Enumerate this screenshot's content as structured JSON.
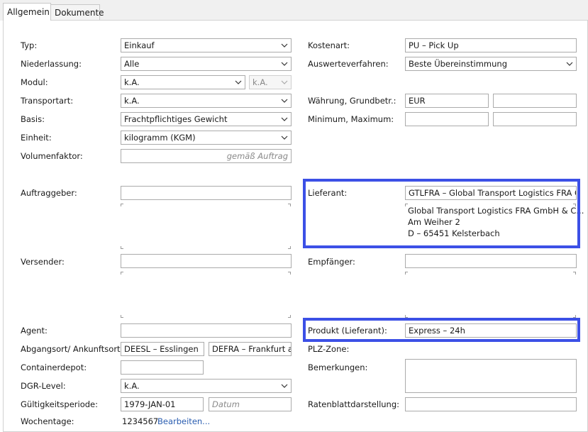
{
  "tabs": [
    "Allgemein",
    "Dokumente"
  ],
  "left": {
    "typ": {
      "label": "Typ:",
      "value": "Einkauf"
    },
    "niederlassung": {
      "label": "Niederlassung:",
      "value": "Alle"
    },
    "modul": {
      "label": "Modul:",
      "value": "k.A.",
      "value2": "k.A."
    },
    "transportart": {
      "label": "Transportart:",
      "value": "k.A."
    },
    "basis": {
      "label": "Basis:",
      "value": "Frachtpflichtiges Gewicht"
    },
    "einheit": {
      "label": "Einheit:",
      "value": "kilogramm (KGM)"
    },
    "volumenfaktor": {
      "label": "Volumenfaktor:",
      "placeholder": "gemäß Auftrag"
    },
    "auftraggeber": {
      "label": "Auftraggeber:"
    },
    "versender": {
      "label": "Versender:"
    },
    "agent": {
      "label": "Agent:"
    },
    "abgangsort": {
      "label": "Abgangsort/ Ankunftsort:",
      "from": "DEESL – Esslingen",
      "to": "DEFRA – Frankfurt an"
    },
    "containerdepot": {
      "label": "Containerdepot:"
    },
    "dgr": {
      "label": "DGR-Level:",
      "value": "k.A."
    },
    "gueltigkeit": {
      "label": "Gültigkeitsperiode:",
      "from": "1979-JAN-01",
      "to_placeholder": "Datum"
    },
    "wochentage": {
      "label": "Wochentage:",
      "value": "1234567",
      "link": "Bearbeiten..."
    }
  },
  "right": {
    "kostenart": {
      "label": "Kostenart:",
      "value": "PU – Pick Up"
    },
    "auswerteverfahren": {
      "label": "Auswerteverfahren:",
      "value": "Beste Übereinstimmung"
    },
    "waehrung": {
      "label": "Währung, Grundbetr.:",
      "value": "EUR",
      "value2": ""
    },
    "minmax": {
      "label": "Minimum, Maximum:"
    },
    "lieferant": {
      "label": "Lieferant:",
      "value": "GTLFRA – Global Transport Logistics FRA GmbH",
      "address": [
        "Global Transport Logistics FRA GmbH & C...",
        "Am Weiher 2",
        "D – 65451 Kelsterbach"
      ]
    },
    "empfaenger": {
      "label": "Empfänger:"
    },
    "produkt": {
      "label": "Produkt (Lieferant):",
      "value": "Express – 24h"
    },
    "plz": {
      "label": "PLZ-Zone:"
    },
    "bemerkungen": {
      "label": "Bemerkungen:"
    },
    "ratenblatt": {
      "label": "Ratenblattdarstellung:"
    }
  },
  "colors": {
    "highlight": "#3c50e6",
    "link": "#2a5db0"
  }
}
